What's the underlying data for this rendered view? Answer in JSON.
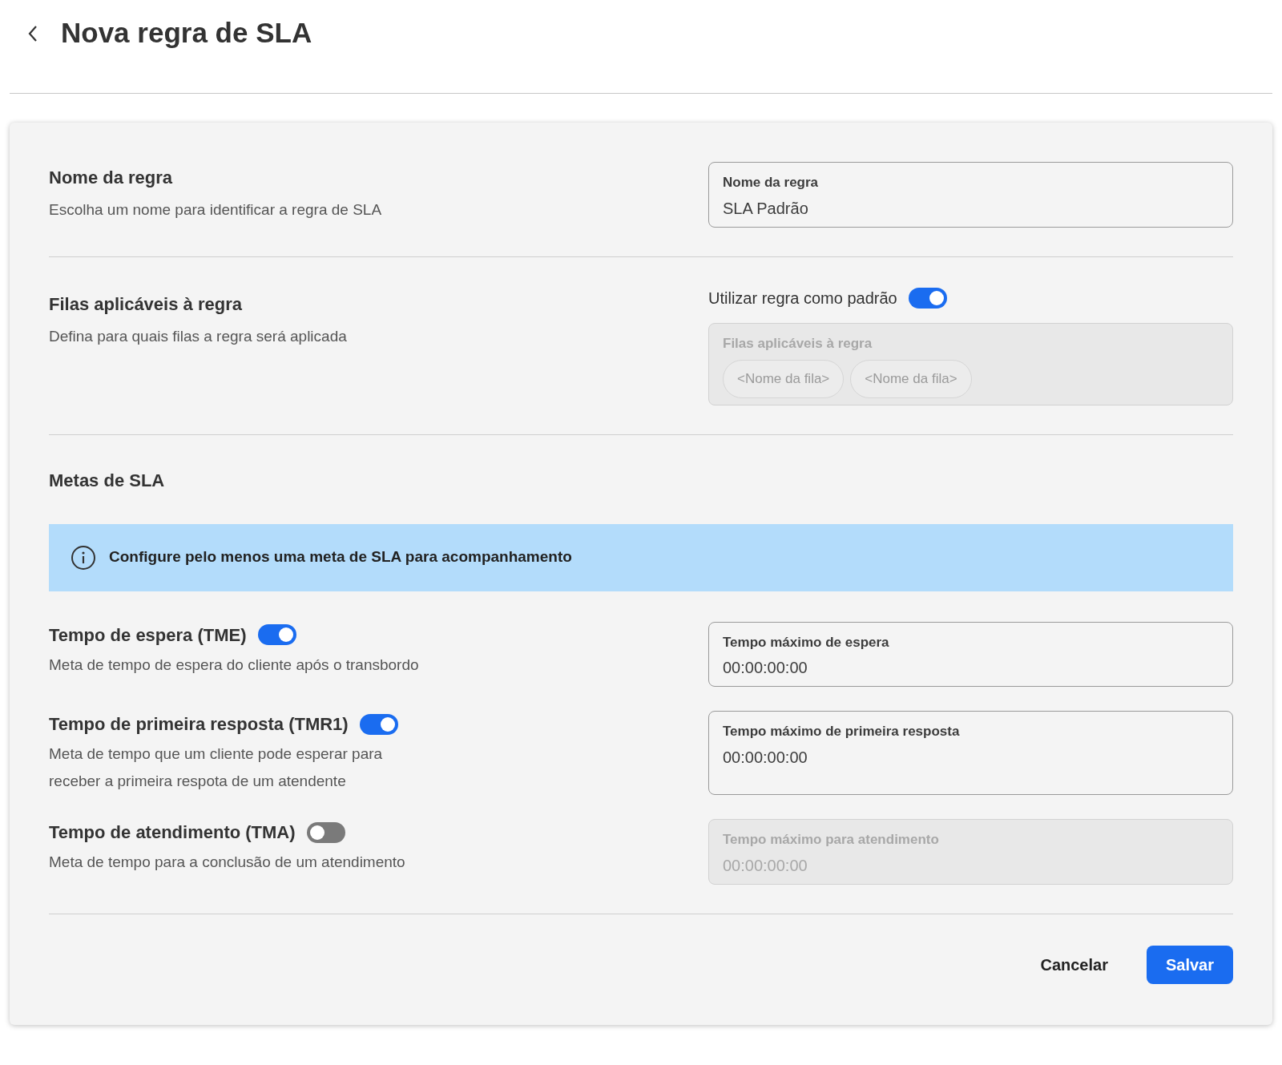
{
  "header": {
    "title": "Nova regra de SLA"
  },
  "rule_name": {
    "title": "Nome da regra",
    "description": "Escolha um nome para identificar a regra de SLA",
    "field": {
      "label": "Nome da regra",
      "value": "SLA Padrão"
    }
  },
  "queues": {
    "title": "Filas aplicáveis à regra",
    "description": "Defina para quais filas a regra será aplicada",
    "default_toggle": {
      "label": "Utilizar regra como padrão",
      "on": true
    },
    "field": {
      "label": "Filas aplicáveis à regra",
      "disabled": true,
      "chips": [
        "<Nome da fila>",
        "<Nome da fila>"
      ]
    }
  },
  "goals": {
    "title": "Metas de SLA",
    "alert": "Configure pelo menos uma meta de SLA para acompanhamento",
    "items": [
      {
        "title": "Tempo de espera (TME)",
        "on": true,
        "description": "Meta de tempo de espera do cliente após o transbordo",
        "field": {
          "label": "Tempo máximo de espera",
          "value": "00:00:00:00"
        }
      },
      {
        "title": "Tempo de primeira resposta (TMR1)",
        "on": true,
        "description": "Meta de tempo que um cliente pode esperar para receber a primeira respota de um atendente",
        "field": {
          "label": "Tempo máximo de primeira resposta",
          "value": "00:00:00:00"
        }
      },
      {
        "title": "Tempo de atendimento (TMA)",
        "on": false,
        "description": "Meta de tempo para a conclusão de um atendimento",
        "field": {
          "label": "Tempo máximo para atendimento",
          "value": "00:00:00:00"
        }
      }
    ]
  },
  "actions": {
    "cancel": "Cancelar",
    "save": "Salvar"
  }
}
